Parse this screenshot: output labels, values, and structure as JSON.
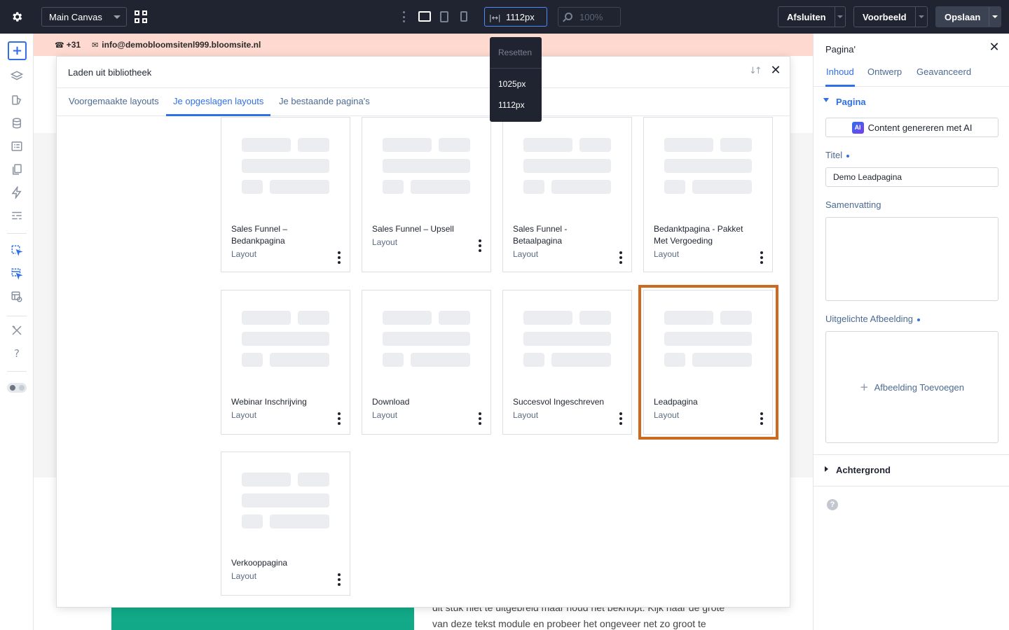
{
  "topbar": {
    "canvas_select": "Main Canvas",
    "width_value": "1112px",
    "zoom_value": "100%",
    "close_label": "Afsluiten",
    "preview_label": "Voorbeeld",
    "save_label": "Opslaan"
  },
  "width_dropdown": {
    "reset": "Resetten",
    "options": [
      "1025px",
      "1112px"
    ]
  },
  "site": {
    "phone": "+31",
    "email": "info@demobloomsitenl999.bloomsite.nl",
    "body_text": "dit stuk niet te uitgebreid maar houd het beknopt. Kijk naar de grote van deze tekst module en probeer het ongeveer net zo groot te"
  },
  "modal": {
    "title": "Laden uit bibliotheek",
    "tabs": [
      "Voorgemaakte layouts",
      "Je opgeslagen layouts",
      "Je bestaande pagina's"
    ],
    "active_tab": "Je opgeslagen layouts",
    "cards": [
      {
        "name": "Sales Funnel – Bedankpagina",
        "type": "Layout"
      },
      {
        "name": "Sales Funnel – Upsell",
        "type": "Layout"
      },
      {
        "name": "Sales Funnel - Betaalpagina",
        "type": "Layout"
      },
      {
        "name": "Bedanktpagina - Pakket Met Vergoeding",
        "type": "Layout"
      },
      {
        "name": "Webinar Inschrijving",
        "type": "Layout"
      },
      {
        "name": "Download",
        "type": "Layout"
      },
      {
        "name": "Succesvol Ingeschreven",
        "type": "Layout"
      },
      {
        "name": "Leadpagina",
        "type": "Layout"
      },
      {
        "name": "Verkooppagina",
        "type": "Layout"
      }
    ],
    "highlighted_card": "Leadpagina",
    "highlight_color": "#cc6b1f"
  },
  "panel": {
    "title": "Pagina'",
    "tabs": [
      "Inhoud",
      "Ontwerp",
      "Geavanceerd"
    ],
    "section": "Pagina",
    "ai_badge": "AI",
    "ai_button": "Content genereren met AI",
    "title_label": "Titel",
    "title_value": "Demo Leadpagina",
    "summary_label": "Samenvatting",
    "image_label": "Uitgelichte Afbeelding",
    "add_image": "Afbeelding Toevoegen",
    "background_section": "Achtergrond",
    "help": "?"
  },
  "colors": {
    "accent": "#2f6fe8",
    "topbar_bg": "#1f2430",
    "site_topbar_bg": "#fdd9cf",
    "site_green": "#11a987"
  }
}
